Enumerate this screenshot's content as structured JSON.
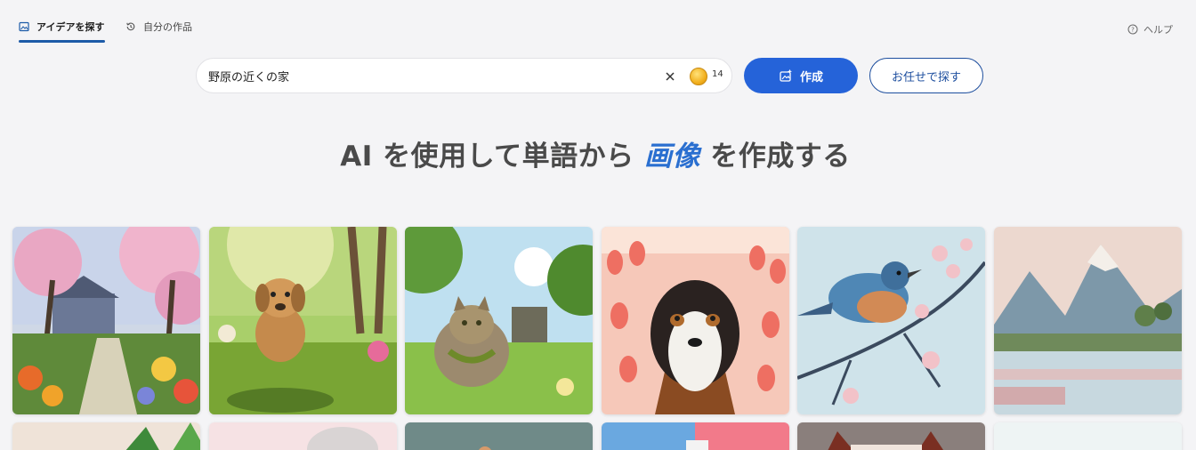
{
  "nav": {
    "tabs": [
      {
        "label": "アイデアを探す",
        "icon": "image-icon",
        "active": true
      },
      {
        "label": "自分の作品",
        "icon": "history-icon",
        "active": false
      }
    ],
    "help_label": "ヘルプ"
  },
  "search": {
    "value": "野原の近くの家",
    "credits": "14"
  },
  "buttons": {
    "create": "作成",
    "surprise": "お任せで探す"
  },
  "headline": {
    "prefix": "AI を使用して単語から ",
    "accent": "画像",
    "suffix": " を作成する"
  },
  "gallery": [
    {
      "name": "cherry-blossom-garden-painting"
    },
    {
      "name": "puppy-running-in-sunny-field"
    },
    {
      "name": "cat-in-sunny-garden"
    },
    {
      "name": "dog-in-tulip-field"
    },
    {
      "name": "bluebird-on-blossom-branch"
    },
    {
      "name": "pastel-mountain-lake-painting"
    }
  ],
  "colors": {
    "accent": "#2563d9",
    "tab_underline": "#1d5ba8",
    "headline_accent": "#2a6fd0"
  }
}
